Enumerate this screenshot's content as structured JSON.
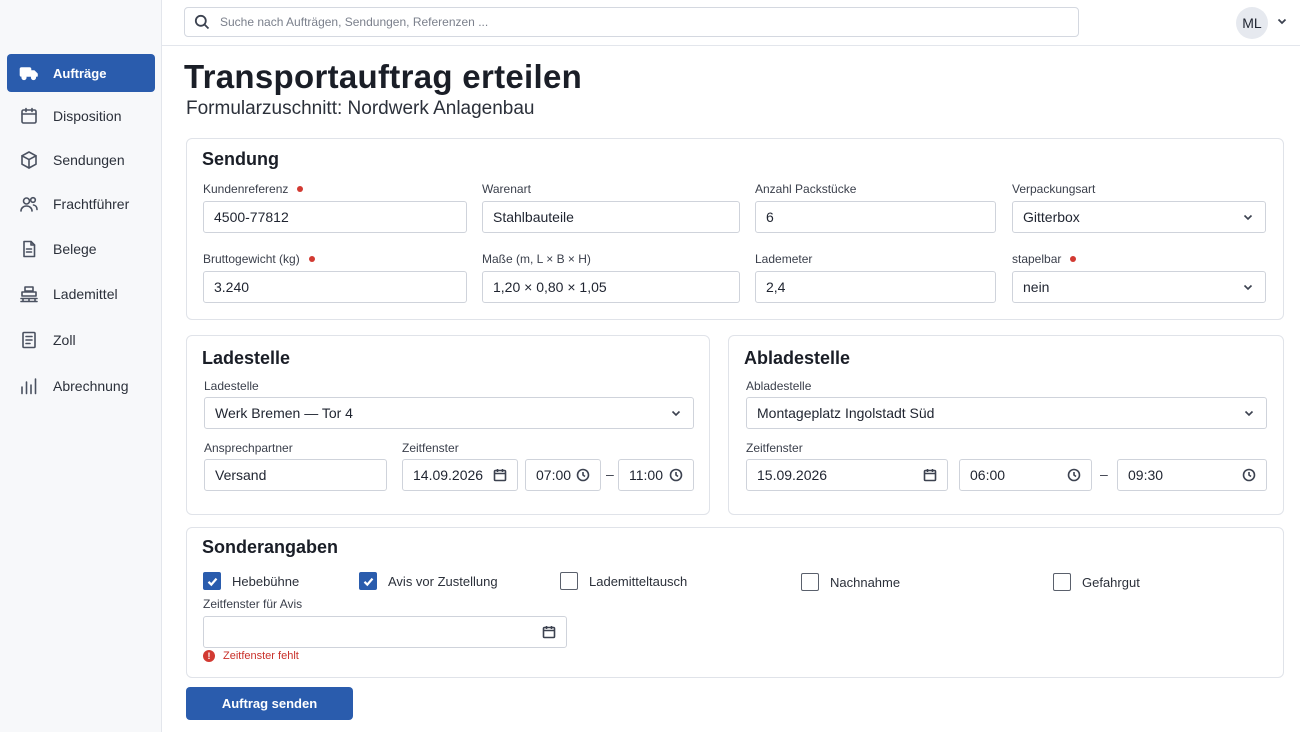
{
  "search": {
    "placeholder": "Suche nach Aufträgen, Sendungen, Referenzen ..."
  },
  "user": {
    "initials": "ML"
  },
  "sidebar": {
    "items": [
      {
        "label": "Aufträge",
        "icon": "truck-icon",
        "active": true
      },
      {
        "label": "Disposition",
        "icon": "calendar-icon"
      },
      {
        "label": "Sendungen",
        "icon": "package-icon"
      },
      {
        "label": "Frachtführer",
        "icon": "users-icon"
      },
      {
        "label": "Belege",
        "icon": "document-icon"
      },
      {
        "label": "Lademittel",
        "icon": "pallet-icon"
      },
      {
        "label": "Zoll",
        "icon": "clipboard-icon"
      },
      {
        "label": "Abrechnung",
        "icon": "bar-chart-icon"
      }
    ]
  },
  "page": {
    "title": "Transportauftrag erteilen",
    "subtitle": "Formularzuschnitt: Nordwerk Anlagenbau"
  },
  "sendung": {
    "title": "Sendung",
    "kundenreferenz": {
      "label": "Kundenreferenz",
      "value": "4500-77812",
      "required": true
    },
    "warenart": {
      "label": "Warenart",
      "value": "Stahlbauteile"
    },
    "packstuecke": {
      "label": "Anzahl Packstücke",
      "value": "6"
    },
    "verpackungsart": {
      "label": "Verpackungsart",
      "value": "Gitterbox"
    },
    "bruttogewicht": {
      "label": "Bruttogewicht (kg)",
      "value": "3.240",
      "required": true
    },
    "masse": {
      "label": "Maße (m, L × B × H)",
      "value": "1,20 × 0,80 × 1,05"
    },
    "lademeter": {
      "label": "Lademeter",
      "value": "2,4"
    },
    "stapelbar": {
      "label": "stapelbar",
      "value": "nein",
      "required": true
    }
  },
  "ladestelle": {
    "title": "Ladestelle",
    "ort": {
      "label": "Ladestelle",
      "value": "Werk Bremen — Tor 4"
    },
    "ansprechpartner": {
      "label": "Ansprechpartner",
      "value": "Versand"
    },
    "zeitfenster": {
      "label": "Zeitfenster",
      "date": "14.09.2026",
      "from": "07:00",
      "to": "11:00"
    }
  },
  "abladestelle": {
    "title": "Abladestelle",
    "ort": {
      "label": "Abladestelle",
      "value": "Montageplatz Ingolstadt Süd"
    },
    "zeitfenster": {
      "label": "Zeitfenster",
      "date": "15.09.2026",
      "from": "06:00",
      "to": "09:30"
    }
  },
  "dash": "–",
  "sonder": {
    "title": "Sonderangaben",
    "options": [
      {
        "label": "Hebebühne",
        "checked": true
      },
      {
        "label": "Avis vor Zustellung",
        "checked": true
      },
      {
        "label": "Lademitteltausch",
        "checked": false
      },
      {
        "label": "Nachnahme",
        "checked": false
      },
      {
        "label": "Gefahrgut",
        "checked": false
      }
    ],
    "avis_label": "Zeitfenster für Avis",
    "avis_value": "",
    "error": "Zeitfenster fehlt"
  },
  "submit_label": "Auftrag senden",
  "colors": {
    "accent": "#2a5cad",
    "error": "#d23a32"
  }
}
